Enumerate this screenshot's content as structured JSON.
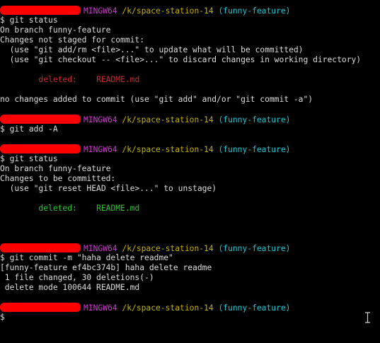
{
  "colors": {
    "background": "#000000",
    "text": "#dcdcdc",
    "redaction": "#ff0000",
    "env": "#d23ad2",
    "path": "#c6b200",
    "branch": "#1ec8d4",
    "deleted_unstaged": "#cc2b2b",
    "deleted_staged": "#2cc62c"
  },
  "prompt": {
    "env": "MINGW64",
    "path": "/k/space-station-14",
    "branch": "(funny-feature)"
  },
  "lines": [
    {
      "type": "prompt"
    },
    {
      "type": "text",
      "text": "$ git status"
    },
    {
      "type": "text",
      "text": "On branch funny-feature"
    },
    {
      "type": "text",
      "text": "Changes not staged for commit:"
    },
    {
      "type": "text",
      "text": "  (use \"git add/rm <file>...\" to update what will be committed)"
    },
    {
      "type": "text",
      "text": "  (use \"git checkout -- <file>...\" to discard changes in working directory)"
    },
    {
      "type": "blank"
    },
    {
      "type": "status",
      "status": "deleted:",
      "file": "README.md",
      "color": "red"
    },
    {
      "type": "blank"
    },
    {
      "type": "text",
      "text": "no changes added to commit (use \"git add\" and/or \"git commit -a\")"
    },
    {
      "type": "blank"
    },
    {
      "type": "prompt"
    },
    {
      "type": "text",
      "text": "$ git add -A"
    },
    {
      "type": "blank"
    },
    {
      "type": "prompt"
    },
    {
      "type": "text",
      "text": "$ git status"
    },
    {
      "type": "text",
      "text": "On branch funny-feature"
    },
    {
      "type": "text",
      "text": "Changes to be committed:"
    },
    {
      "type": "text",
      "text": "  (use \"git reset HEAD <file>...\" to unstage)"
    },
    {
      "type": "blank"
    },
    {
      "type": "status",
      "status": "deleted:",
      "file": "README.md",
      "color": "green"
    },
    {
      "type": "blank"
    },
    {
      "type": "blank"
    },
    {
      "type": "blank"
    },
    {
      "type": "prompt"
    },
    {
      "type": "text",
      "text": "$ git commit -m \"haha delete readme\""
    },
    {
      "type": "text",
      "text": "[funny-feature ef4bc374b] haha delete readme"
    },
    {
      "type": "text",
      "text": " 1 file changed, 30 deletions(-)"
    },
    {
      "type": "text",
      "text": " delete mode 100644 README.md"
    },
    {
      "type": "blank"
    },
    {
      "type": "prompt"
    },
    {
      "type": "text",
      "text": "$"
    }
  ]
}
